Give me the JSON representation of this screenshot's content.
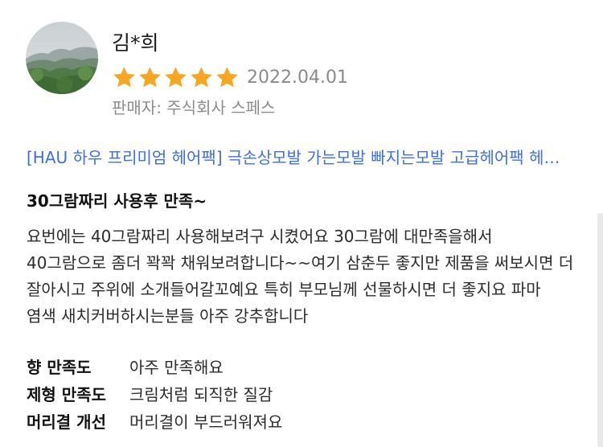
{
  "reviewer": {
    "name": "김*희",
    "avatar_icon": "profile-photo-mountain-landscape"
  },
  "rating": {
    "stars": 5,
    "max": 5,
    "star_color": "#F5A623"
  },
  "date": "2022.04.01",
  "seller": "판매자: 주식회사 스페스",
  "product": {
    "title": "[HAU 하우 프리미엄 헤어팩] 극손상모발 가는모발 빠지는모발 고급헤어팩 헤어트리트먼트",
    "link_color": "#3D6FE0"
  },
  "review": {
    "title": "30그람짜리 사용후 만족~",
    "body": "요번에는 40그람짜리 사용해보려구 시켰어요  30그람에 대만족을해서 40그람으로 좀더 꽉꽉 채워보려합니다~~여기 삼춘두 좋지만  제품을 써보시면 더 잘아시고 주위에 소개들어갈꼬예요  특히 부모님께 선물하시면 더 좋지요  파마 염색  새치커버하시는분들 아주 강추합니다"
  },
  "attributes": [
    {
      "label": "향 만족도",
      "value": "아주 만족해요"
    },
    {
      "label": "제형 만족도",
      "value": "크림처럼 되직한 질감"
    },
    {
      "label": "머리결 개선",
      "value": "머리결이 부드러워져요"
    }
  ]
}
